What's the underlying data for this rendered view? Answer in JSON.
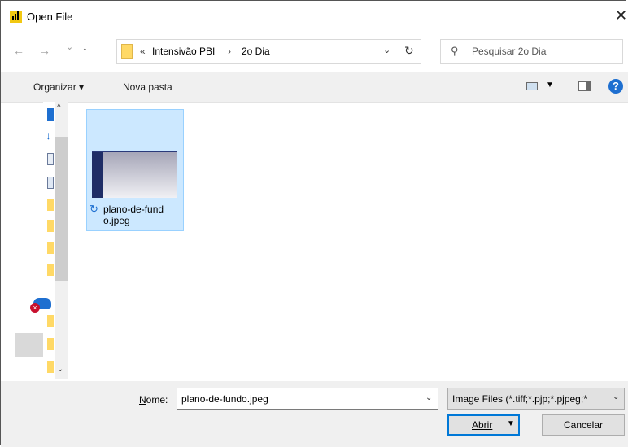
{
  "window": {
    "title": "Open File",
    "app_icon": "power-bi-icon",
    "close_glyph": "✕"
  },
  "nav": {
    "back_glyph": "←",
    "forward_glyph": "→",
    "recent_glyph": "⌄",
    "up_glyph": "↑",
    "refresh_glyph": "↻",
    "address": {
      "overflow": "«",
      "crumbs": [
        "Intensivão PBI",
        "2o Dia"
      ],
      "separator": "›",
      "dropdown_glyph": "⌄"
    },
    "search_placeholder": "Pesquisar 2o Dia",
    "search_glyph": "⚲"
  },
  "toolbar": {
    "organize_label": "Organizar ▾",
    "new_folder_label": "Nova pasta",
    "view_dropdown_glyph": "▼",
    "help_glyph": "?"
  },
  "nav_pane": {
    "scroll_up_glyph": "^",
    "scroll_down_glyph": "⌄",
    "icons": [
      "blue-folder-icon",
      "download-arrow-icon",
      "document-icon",
      "image-icon",
      "folder-icon",
      "folder-icon",
      "folder-icon",
      "folder-icon",
      "onedrive-error-icon",
      "folder-icon",
      "folder-icon",
      "folder-icon"
    ]
  },
  "files": [
    {
      "name": "plano-de-fund o.jpeg",
      "status_glyph": "↻",
      "selected": true
    }
  ],
  "footer": {
    "filename_label_underlined": "N",
    "filename_label_rest": "ome:",
    "filename_value": "plano-de-fundo.jpeg",
    "filename_dropdown_glyph": "⌄",
    "filetype_value": "Image Files (*.tiff;*.pjp;*.pjpeg;*",
    "filetype_dropdown_glyph": "⌄",
    "open_label": "Abrir",
    "open_dropdown_glyph": "▼",
    "cancel_label": "Cancelar"
  },
  "colors": {
    "accent": "#0078d7",
    "selection": "#cce8ff",
    "chrome": "#f0f0f0",
    "folder": "#ffd966",
    "powerbi": "#f2c811"
  }
}
